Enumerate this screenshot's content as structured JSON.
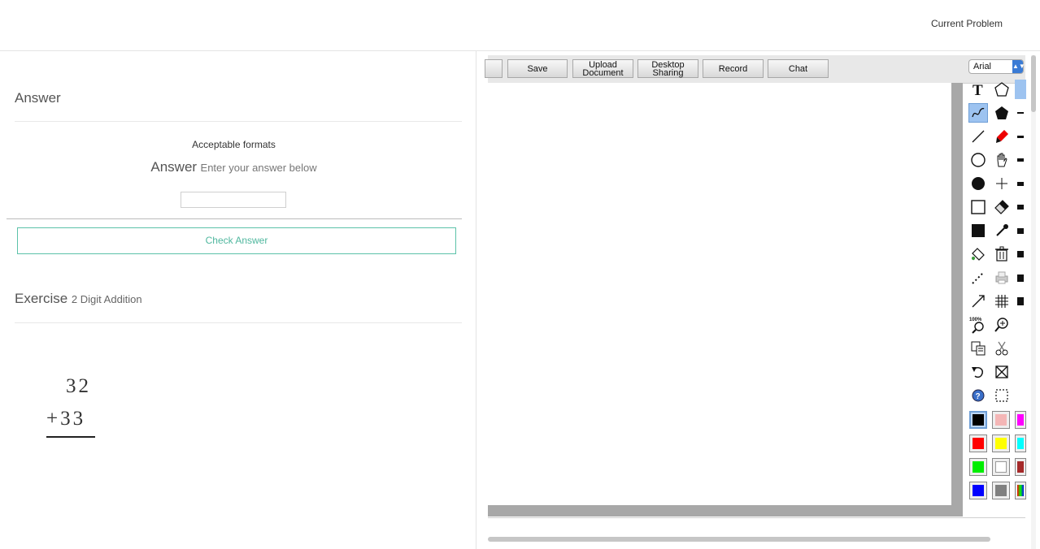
{
  "header": {
    "current_problem": "Current Problem"
  },
  "answer_section": {
    "title": "Answer",
    "acceptable_formats": "Acceptable formats",
    "answer_label": "Answer",
    "answer_hint": "Enter your answer below",
    "input_value": "",
    "check_button": "Check Answer"
  },
  "exercise": {
    "title": "Exercise",
    "subtitle": "2 Digit Addition",
    "top_number": "32",
    "bottom_number": "+33"
  },
  "whiteboard": {
    "toolbar": {
      "save": "Save",
      "upload_line1": "Upload",
      "upload_line2": "Document",
      "desktop_line1": "Desktop",
      "desktop_line2": "Sharing",
      "record": "Record",
      "chat": "Chat"
    },
    "font": "Arial",
    "tools": [
      {
        "name": "text-tool-icon"
      },
      {
        "name": "polygon-outline-icon"
      },
      {
        "name": "curve-tool-icon"
      },
      {
        "name": "polygon-filled-icon"
      },
      {
        "name": "line-tool-icon"
      },
      {
        "name": "marker-icon"
      },
      {
        "name": "circle-outline-icon"
      },
      {
        "name": "hand-pan-icon"
      },
      {
        "name": "circle-filled-icon"
      },
      {
        "name": "crosshair-icon"
      },
      {
        "name": "square-outline-icon"
      },
      {
        "name": "eraser-icon"
      },
      {
        "name": "square-filled-icon"
      },
      {
        "name": "eyedropper-icon"
      },
      {
        "name": "paint-bucket-icon"
      },
      {
        "name": "trash-icon"
      },
      {
        "name": "dotted-line-icon"
      },
      {
        "name": "printer-icon"
      },
      {
        "name": "arrow-line-icon"
      },
      {
        "name": "grid-icon"
      },
      {
        "name": "zoom-100-icon"
      },
      {
        "name": "zoom-in-icon"
      },
      {
        "name": "copy-icon"
      },
      {
        "name": "cut-icon"
      },
      {
        "name": "undo-icon"
      },
      {
        "name": "clear-icon"
      },
      {
        "name": "help-icon"
      },
      {
        "name": "select-region-icon"
      }
    ],
    "colors": [
      "#000000",
      "#f4b6b6",
      "#ff0000",
      "#ffff00",
      "#00ee00",
      "#ffffff",
      "#0000ff",
      "#808080"
    ],
    "partial_colors": [
      "#ff00ff",
      "#00ffff",
      "#a52a2a"
    ]
  }
}
